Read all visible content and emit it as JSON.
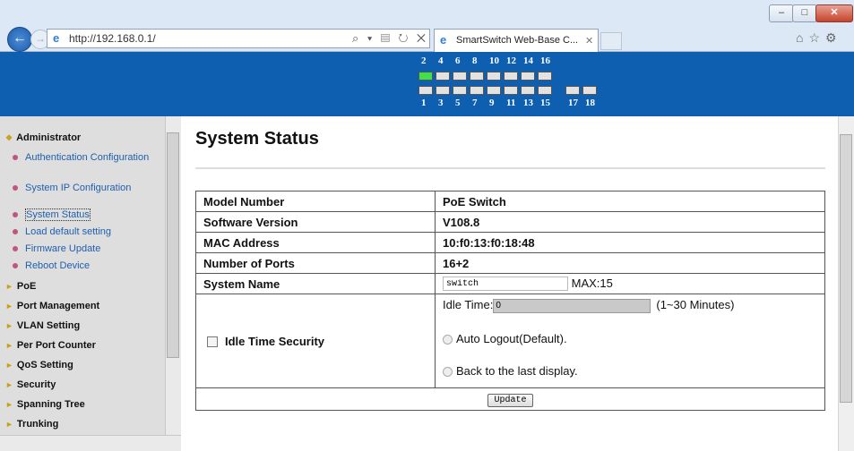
{
  "browser": {
    "url": "http://192.168.0.1/",
    "tab_title": "SmartSwitch Web-Base C...",
    "addr_tools": "⌕ ▾ ▤ ↻ ✕",
    "right_icons": "⌂☆⚙"
  },
  "ports": {
    "top_labels": [
      "2",
      "4",
      "6",
      "8",
      "10",
      "12",
      "14",
      "16"
    ],
    "bottom_labels": [
      "1",
      "3",
      "5",
      "7",
      "9",
      "11",
      "13",
      "15",
      "17",
      "18"
    ],
    "active_port": "2"
  },
  "sidebar": {
    "administrator": "Administrator",
    "admin_items": [
      "Authentication Configuration",
      "System IP Configuration",
      "System Status",
      "Load default setting",
      "Firmware Update",
      "Reboot Device"
    ],
    "sections": [
      "PoE",
      "Port Management",
      "VLAN Setting",
      "Per Port Counter",
      "QoS Setting",
      "Security",
      "Spanning Tree",
      "Trunking"
    ]
  },
  "main": {
    "title": "System Status",
    "rows": [
      {
        "label": "Model Number",
        "value": "PoE Switch"
      },
      {
        "label": "Software Version",
        "value": "V108.8"
      },
      {
        "label": "MAC Address",
        "value": "10:f0:13:f0:18:48"
      },
      {
        "label": "Number of Ports",
        "value": "16+2"
      }
    ],
    "system_name_label": "System Name",
    "system_name_value": "switch",
    "system_name_max": "MAX:15",
    "idle_label": "Idle Time Security",
    "idle_time_label": "Idle Time:",
    "idle_time_value": "0",
    "idle_range": "(1~30 Minutes)",
    "auto_logout": "Auto Logout(Default).",
    "back_last": "Back to the last display.",
    "update": "Update"
  }
}
